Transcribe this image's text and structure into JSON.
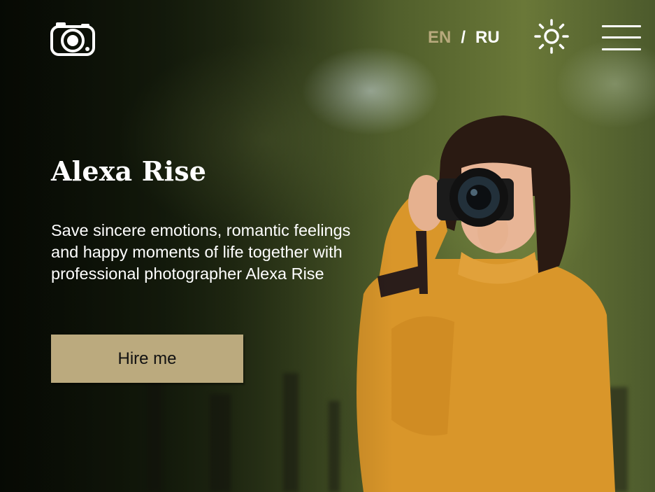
{
  "header": {
    "logo_icon": "camera-icon",
    "lang": {
      "en": "EN",
      "separator": "/",
      "ru": "RU"
    },
    "theme_icon": "sun-icon",
    "menu_icon": "hamburger-menu-icon"
  },
  "hero": {
    "title": "Alexa Rise",
    "description_lines": [
      "Save sincere emotions, romantic feelings",
      "and happy moments of life together with",
      "professional photographer Alexa Rise"
    ],
    "cta_label": "Hire me"
  },
  "colors": {
    "accent": "#bbaa7e",
    "lang_inactive": "#b7a97c",
    "text": "#ffffff"
  }
}
